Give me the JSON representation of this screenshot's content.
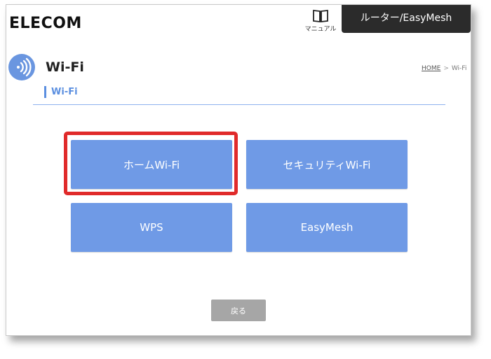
{
  "header": {
    "logo_text": "ELECOM",
    "manual_label": "マニュアル",
    "manual_icon": "book-icon",
    "mode_tab_label": "ルーター/EasyMesh"
  },
  "page": {
    "icon": "wifi-icon",
    "title": "Wi-Fi",
    "section_heading": "Wi-Fi"
  },
  "breadcrumb": {
    "home": "HOME",
    "separator": ">",
    "current": "Wi-Fi"
  },
  "menu": {
    "home_wifi": "ホームWi-Fi",
    "security_wifi": "セキュリティWi-Fi",
    "wps": "WPS",
    "easymesh": "EasyMesh"
  },
  "footer": {
    "back_label": "戻る"
  },
  "colors": {
    "accent": "#6f9ae6",
    "highlight": "#e02a2a",
    "header_tab": "#2b2b2b",
    "back_button": "#a6a6a6"
  }
}
